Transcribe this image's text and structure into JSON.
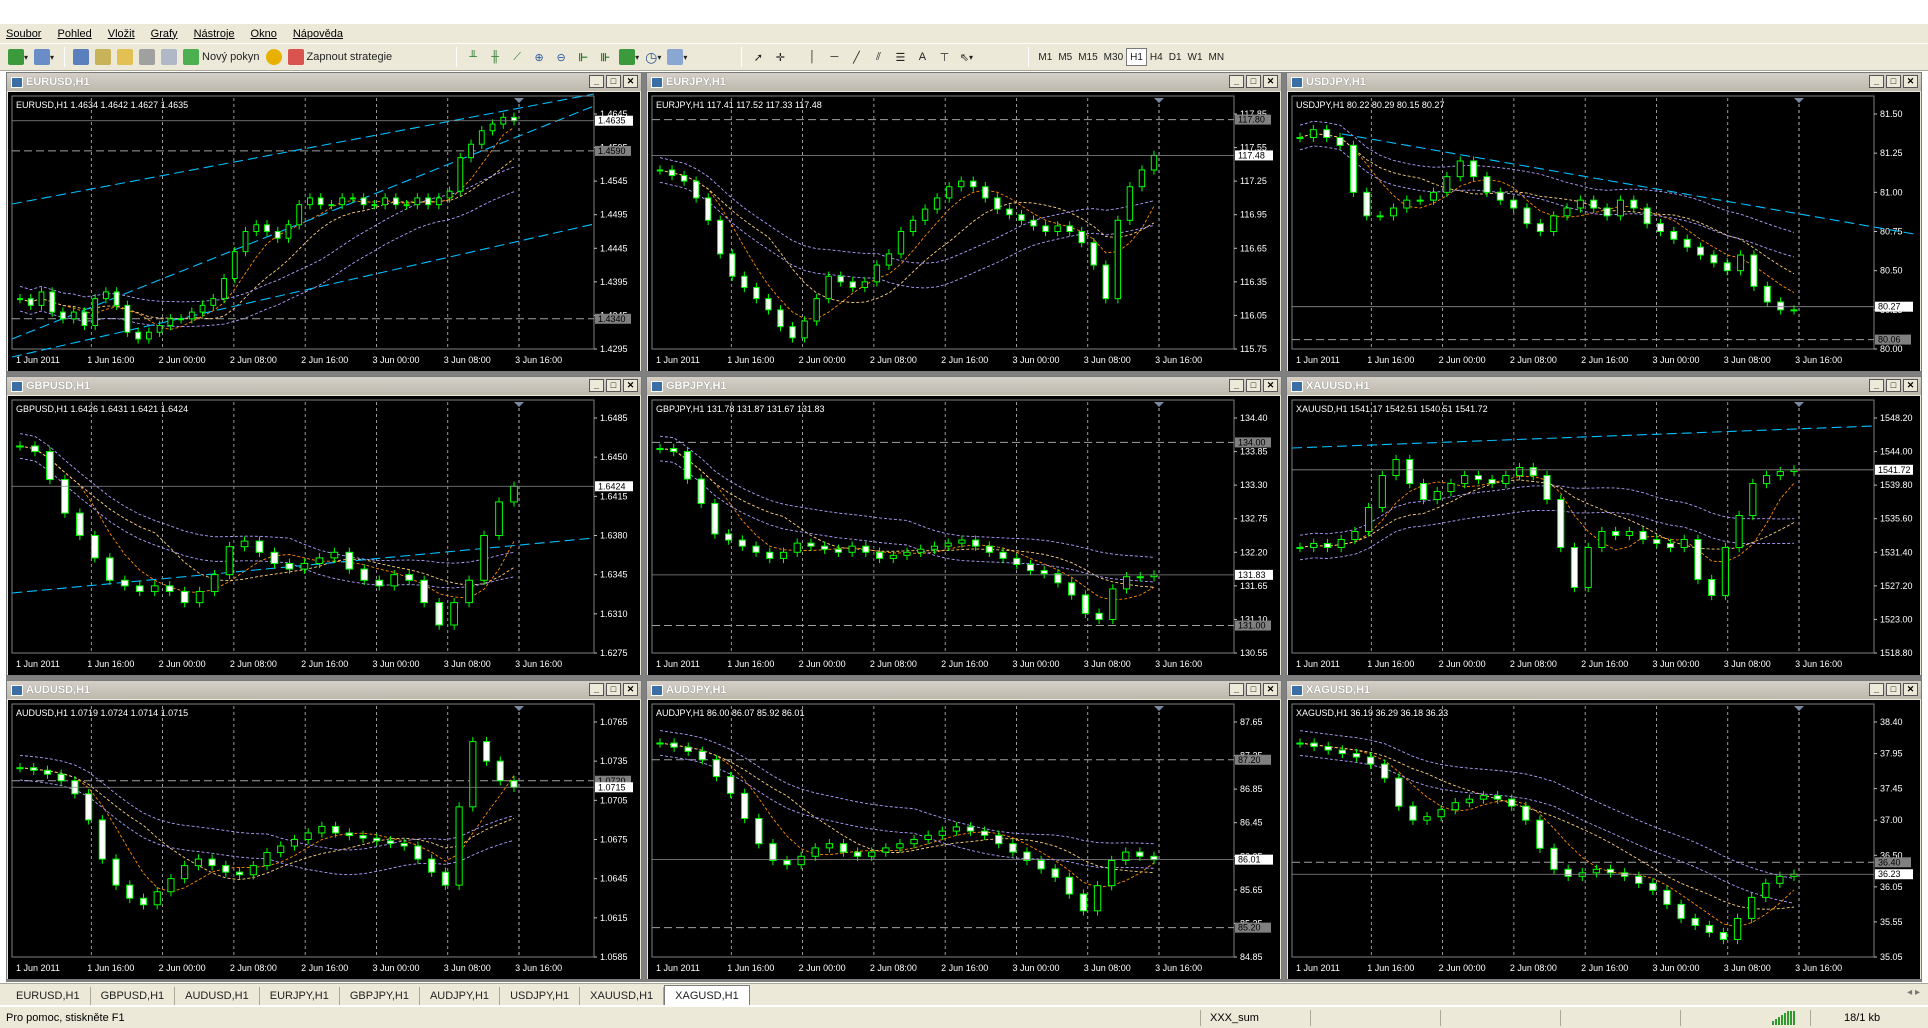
{
  "menubar": {
    "items": [
      "Soubor",
      "Pohled",
      "Vložit",
      "Grafy",
      "Nástroje",
      "Okno",
      "Nápověda"
    ]
  },
  "toolbar": {
    "new_order_label": "Nový pokyn",
    "enable_strategies_label": "Zapnout strategie",
    "timeframes": [
      "M1",
      "M5",
      "M15",
      "M30",
      "H1",
      "H4",
      "D1",
      "W1",
      "MN"
    ],
    "active_timeframe": "H1"
  },
  "colors": {
    "background": "#000000",
    "candle": "#00ff00",
    "grid": "#c0c0c0",
    "trendline": "#00bfff",
    "ma_fast": "#ff8c00",
    "ma_mid": "#ffd27f",
    "ma_slow": "#b0a0ff"
  },
  "time_labels": [
    "1 Jun 2011",
    "1 Jun 16:00",
    "2 Jun 00:00",
    "2 Jun 08:00",
    "2 Jun 16:00",
    "3 Jun 00:00",
    "3 Jun 08:00",
    "3 Jun 16:00"
  ],
  "charts": [
    {
      "title": "EURUSD,H1",
      "ohlc": "EURUSD,H1  1.4634 1.4642 1.4627 1.4635",
      "ticks": [
        "1.4645",
        "1.4595",
        "1.4545",
        "1.4495",
        "1.4445",
        "1.4395",
        "1.4345",
        "1.4295"
      ],
      "price_tag": "1.4635",
      "hlines": [
        "1.4590",
        "1.4340"
      ],
      "series": [
        1.437,
        1.436,
        1.438,
        1.435,
        1.434,
        1.435,
        1.433,
        1.437,
        1.438,
        1.436,
        1.432,
        1.431,
        1.432,
        1.433,
        1.434,
        1.434,
        1.435,
        1.436,
        1.437,
        1.44,
        1.444,
        1.447,
        1.448,
        1.447,
        1.446,
        1.448,
        1.451,
        1.452,
        1.451,
        1.451,
        1.452,
        1.452,
        1.451,
        1.451,
        1.452,
        1.451,
        1.451,
        1.452,
        1.451,
        1.452,
        1.453,
        1.458,
        1.46,
        1.462,
        1.463,
        1.464,
        1.4635
      ],
      "trend": true,
      "trend_dir": "up"
    },
    {
      "title": "EURJPY,H1",
      "ohlc": "EURJPY,H1  117.41 117.52 117.33 117.48",
      "ticks": [
        "117.85",
        "117.55",
        "117.25",
        "116.95",
        "116.65",
        "116.35",
        "116.05",
        "115.75"
      ],
      "price_tag": "117.48",
      "hlines": [
        "117.80"
      ],
      "series": [
        117.35,
        117.3,
        117.25,
        117.1,
        116.9,
        116.6,
        116.4,
        116.3,
        116.2,
        116.1,
        115.95,
        115.85,
        116.0,
        116.2,
        116.4,
        116.35,
        116.3,
        116.35,
        116.5,
        116.6,
        116.8,
        116.9,
        117.0,
        117.1,
        117.2,
        117.25,
        117.2,
        117.1,
        117.0,
        116.95,
        116.9,
        116.85,
        116.8,
        116.85,
        116.8,
        116.7,
        116.5,
        116.2,
        116.9,
        117.2,
        117.35,
        117.48
      ],
      "trend": false
    },
    {
      "title": "USDJPY,H1",
      "ohlc": "USDJPY,H1  80.22 80.29 80.15 80.27",
      "ticks": [
        "81.50",
        "81.25",
        "81.00",
        "80.75",
        "80.50",
        "80.25",
        "80.00"
      ],
      "price_tag": "80.27",
      "hlines": [
        "80.06"
      ],
      "series": [
        81.35,
        81.4,
        81.35,
        81.3,
        81.0,
        80.85,
        80.85,
        80.9,
        80.95,
        80.95,
        81.0,
        81.1,
        81.2,
        81.1,
        81.0,
        80.95,
        80.9,
        80.8,
        80.75,
        80.85,
        80.9,
        80.95,
        80.9,
        80.85,
        80.95,
        80.9,
        80.8,
        80.75,
        80.7,
        80.65,
        80.6,
        80.55,
        80.5,
        80.6,
        80.4,
        80.3,
        80.25,
        80.25
      ],
      "trend": true,
      "trend_dir": "down"
    },
    {
      "title": "GBPUSD,H1",
      "ohlc": "GBPUSD,H1  1.6426 1.6431 1.6421 1.6424",
      "ticks": [
        "1.6485",
        "1.6450",
        "1.6415",
        "1.6380",
        "1.6345",
        "1.6310",
        "1.6275"
      ],
      "price_tag": "1.6424",
      "hlines": [],
      "series": [
        1.646,
        1.6455,
        1.643,
        1.64,
        1.638,
        1.636,
        1.634,
        1.6335,
        1.633,
        1.6335,
        1.633,
        1.632,
        1.633,
        1.6345,
        1.637,
        1.6375,
        1.6365,
        1.6355,
        1.635,
        1.6355,
        1.636,
        1.6365,
        1.635,
        1.634,
        1.6335,
        1.6345,
        1.634,
        1.632,
        1.63,
        1.632,
        1.634,
        1.638,
        1.641,
        1.6424
      ],
      "trend": true,
      "trend_dir": "flat"
    },
    {
      "title": "GBPJPY,H1",
      "ohlc": "GBPJPY,H1  131.78 131.87 131.67 131.83",
      "ticks": [
        "134.40",
        "133.85",
        "133.30",
        "132.75",
        "132.20",
        "131.65",
        "131.10",
        "130.55"
      ],
      "price_tag": "131.83",
      "hlines": [
        "134.00",
        "131.00"
      ],
      "series": [
        133.9,
        133.85,
        133.4,
        133.0,
        132.5,
        132.4,
        132.3,
        132.2,
        132.1,
        132.2,
        132.35,
        132.3,
        132.25,
        132.2,
        132.3,
        132.2,
        132.1,
        132.15,
        132.2,
        132.25,
        132.3,
        132.35,
        132.4,
        132.3,
        132.2,
        132.1,
        132.0,
        131.9,
        131.85,
        131.7,
        131.5,
        131.2,
        131.1,
        131.6,
        131.8,
        131.8,
        131.83
      ],
      "trend": false
    },
    {
      "title": "XAUUSD,H1",
      "ohlc": "XAUUSD,H1  1541.17 1542.51 1540.51 1541.72",
      "ticks": [
        "1548.20",
        "1544.00",
        "1539.80",
        "1535.60",
        "1531.40",
        "1527.20",
        "1523.00",
        "1518.80"
      ],
      "price_tag": "1541.72",
      "hlines": [],
      "series": [
        1532.0,
        1532.5,
        1532.0,
        1533.0,
        1534.0,
        1537.0,
        1541.0,
        1543.0,
        1540.0,
        1538.0,
        1539.0,
        1540.0,
        1541.0,
        1540.5,
        1540.0,
        1541.0,
        1542.0,
        1541.0,
        1538.0,
        1532.0,
        1527.0,
        1532.0,
        1534.0,
        1533.5,
        1534.0,
        1533.0,
        1532.5,
        1532.0,
        1533.0,
        1528.0,
        1526.0,
        1532.0,
        1536.0,
        1540.0,
        1541.0,
        1541.5,
        1541.72
      ],
      "trend": true,
      "trend_dir": "up-slow"
    },
    {
      "title": "AUDUSD,H1",
      "ohlc": "AUDUSD,H1  1.0719 1.0724 1.0714 1.0715",
      "ticks": [
        "1.0765",
        "1.0735",
        "1.0705",
        "1.0675",
        "1.0645",
        "1.0615",
        "1.0585"
      ],
      "price_tag": "1.0715",
      "hlines": [
        "1.0720"
      ],
      "series": [
        1.073,
        1.0728,
        1.0725,
        1.072,
        1.071,
        1.069,
        1.066,
        1.064,
        1.063,
        1.0625,
        1.0635,
        1.0645,
        1.0655,
        1.066,
        1.0655,
        1.065,
        1.0648,
        1.0655,
        1.0665,
        1.067,
        1.0675,
        1.068,
        1.0685,
        1.068,
        1.0678,
        1.0676,
        1.0674,
        1.0672,
        1.067,
        1.066,
        1.065,
        1.064,
        1.07,
        1.075,
        1.0735,
        1.072,
        1.0715
      ],
      "trend": false
    },
    {
      "title": "AUDJPY,H1",
      "ohlc": "AUDJPY,H1  86.00 86.07 85.92 86.01",
      "ticks": [
        "87.65",
        "87.25",
        "86.85",
        "86.45",
        "86.05",
        "85.65",
        "85.25",
        "84.85"
      ],
      "price_tag": "86.01",
      "hlines": [
        "87.20",
        "85.20"
      ],
      "series": [
        87.4,
        87.35,
        87.3,
        87.2,
        87.0,
        86.8,
        86.5,
        86.2,
        86.0,
        85.95,
        86.05,
        86.15,
        86.2,
        86.1,
        86.05,
        86.1,
        86.15,
        86.2,
        86.25,
        86.3,
        86.35,
        86.4,
        86.35,
        86.3,
        86.2,
        86.1,
        86.0,
        85.9,
        85.8,
        85.6,
        85.4,
        85.7,
        86.0,
        86.1,
        86.05,
        86.01
      ],
      "trend": false
    },
    {
      "title": "XAGUSD,H1",
      "ohlc": "XAGUSD,H1  36.19 36.29 36.18 36.23",
      "ticks": [
        "38.40",
        "37.95",
        "37.45",
        "37.00",
        "36.50",
        "36.05",
        "35.55",
        "35.05"
      ],
      "price_tag": "36.23",
      "hlines": [
        "36.40"
      ],
      "series": [
        38.1,
        38.05,
        38.0,
        37.95,
        37.9,
        37.8,
        37.6,
        37.2,
        37.0,
        37.05,
        37.15,
        37.25,
        37.3,
        37.35,
        37.3,
        37.2,
        37.0,
        36.6,
        36.3,
        36.2,
        36.25,
        36.3,
        36.25,
        36.2,
        36.1,
        36.0,
        35.8,
        35.6,
        35.5,
        35.4,
        35.3,
        35.6,
        35.9,
        36.1,
        36.2,
        36.23
      ],
      "trend": false
    }
  ],
  "tabs": [
    "EURUSD,H1",
    "GBPUSD,H1",
    "AUDUSD,H1",
    "EURJPY,H1",
    "GBPJPY,H1",
    "AUDJPY,H1",
    "USDJPY,H1",
    "XAUUSD,H1",
    "XAGUSD,H1"
  ],
  "active_tab": "XAGUSD,H1",
  "status": {
    "help_text": "Pro pomoc, stiskněte F1",
    "profile": "XXX_sum",
    "traffic": "18/1 kb"
  }
}
